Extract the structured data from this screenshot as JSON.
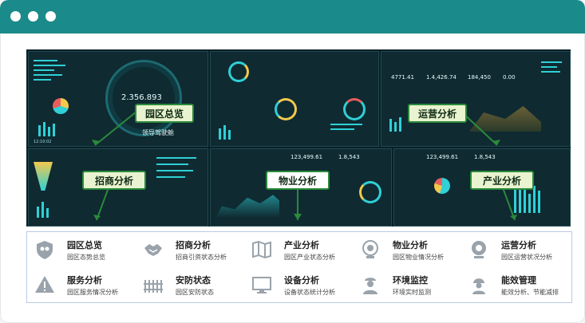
{
  "dashboard": {
    "center_number": "2.356.893",
    "center_title": "领导驾驶舱",
    "ops_numbers": [
      "4771.41",
      "1.4,426.74",
      "184,450",
      "0.00"
    ],
    "zone_numbers": [
      "123,499.61",
      "1.8,543",
      "123,499.61",
      "1.8,543"
    ],
    "time": "12:10:02"
  },
  "callouts": {
    "overview": "园区总览",
    "ops": "运营分析",
    "invest": "招商分析",
    "property": "物业分析",
    "industry": "产业分析"
  },
  "features": [
    {
      "title": "园区总览",
      "sub": "园区态势总览",
      "icon": "shield-people-icon"
    },
    {
      "title": "招商分析",
      "sub": "招商引资状态分析",
      "icon": "handshake-icon"
    },
    {
      "title": "产业分析",
      "sub": "园区产业状态分析",
      "icon": "map-icon"
    },
    {
      "title": "物业分析",
      "sub": "园区物业情况分析",
      "icon": "camera-icon"
    },
    {
      "title": "运营分析",
      "sub": "园区运营状况分析",
      "icon": "webcam-icon"
    },
    {
      "title": "服务分析",
      "sub": "园区服务情况分析",
      "icon": "warning-icon"
    },
    {
      "title": "安防状态",
      "sub": "园区安防状态",
      "icon": "fence-icon"
    },
    {
      "title": "设备分析",
      "sub": "设备状态统计分析",
      "icon": "monitor-icon"
    },
    {
      "title": "环境监控",
      "sub": "环境实时监测",
      "icon": "guard-icon"
    },
    {
      "title": "能效管理",
      "sub": "能效分析、节能减排",
      "icon": "worker-icon"
    }
  ]
}
